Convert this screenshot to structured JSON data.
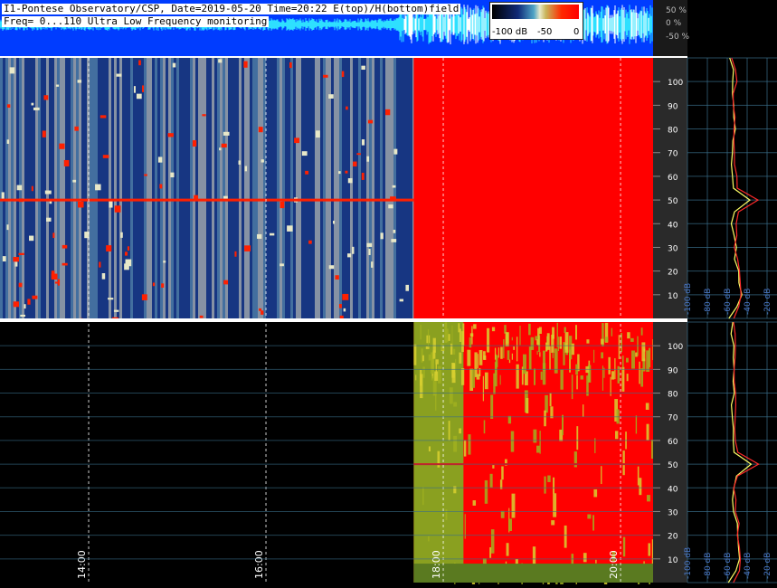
{
  "header": {
    "line1": "I1-Pontese Observatory/CSP, Date=2019-05-20 Time=20:22 E(top)/H(bottom)field",
    "line2": "Freq= 0...110 Ultra Low Frequency monitoring"
  },
  "colorbar": {
    "labels": [
      "-100 dB",
      "-50",
      "0"
    ]
  },
  "amplitude_scale": {
    "labels": [
      "50 %",
      "0 %",
      "-50 %"
    ]
  },
  "colors": {
    "background": "#000000",
    "saturated": "#ff0000",
    "low": "#102a78",
    "mid": "#e8e8c8",
    "grid": "#3a6e8a"
  },
  "chart_data": [
    {
      "type": "heatmap",
      "panel": "E field spectrogram (top)",
      "x_range": [
        "13:00",
        "20:22"
      ],
      "y_range": [
        0,
        110
      ],
      "ytick_labels": [
        "10",
        "20",
        "30",
        "40",
        "50",
        "60",
        "70",
        "80",
        "90",
        "100"
      ],
      "saturation_onset": "17:40",
      "persistent_line_hz": 50
    },
    {
      "type": "heatmap",
      "panel": "H field spectrogram (bottom)",
      "x_range": [
        "13:00",
        "20:22"
      ],
      "xtick_labels": [
        "14:00",
        "16:00",
        "18:00",
        "20:00"
      ],
      "y_range": [
        0,
        110
      ],
      "ytick_labels": [
        "10",
        "20",
        "30",
        "40",
        "50",
        "60",
        "70",
        "80",
        "90",
        "100"
      ],
      "data_start": "17:40"
    },
    {
      "type": "line",
      "panel": "spectrum profiles (right)",
      "xtick_labels": [
        "-100 dB",
        "-80 dB",
        "-60 dB",
        "-40 dB",
        "-20 dB"
      ],
      "y": [
        0,
        5,
        10,
        15,
        20,
        25,
        30,
        35,
        40,
        45,
        50,
        55,
        60,
        65,
        70,
        75,
        80,
        85,
        90,
        95,
        100,
        105,
        110
      ],
      "series": [
        {
          "color": "#ffff66",
          "values": [
            -60,
            -50,
            -46,
            -48,
            -50,
            -51,
            -52,
            -54,
            -55,
            -52,
            -38,
            -52,
            -53,
            -54,
            -55,
            -54,
            -53,
            -54,
            -55,
            -54,
            -53,
            -55,
            -56
          ]
        },
        {
          "color": "#ff2a2a",
          "values": [
            -55,
            -48,
            -45,
            -47,
            -49,
            -50,
            -51,
            -52,
            -53,
            -50,
            -30,
            -50,
            -51,
            -52,
            -53,
            -53,
            -52,
            -53,
            -54,
            -53,
            -52,
            -53,
            -54
          ]
        }
      ]
    }
  ]
}
